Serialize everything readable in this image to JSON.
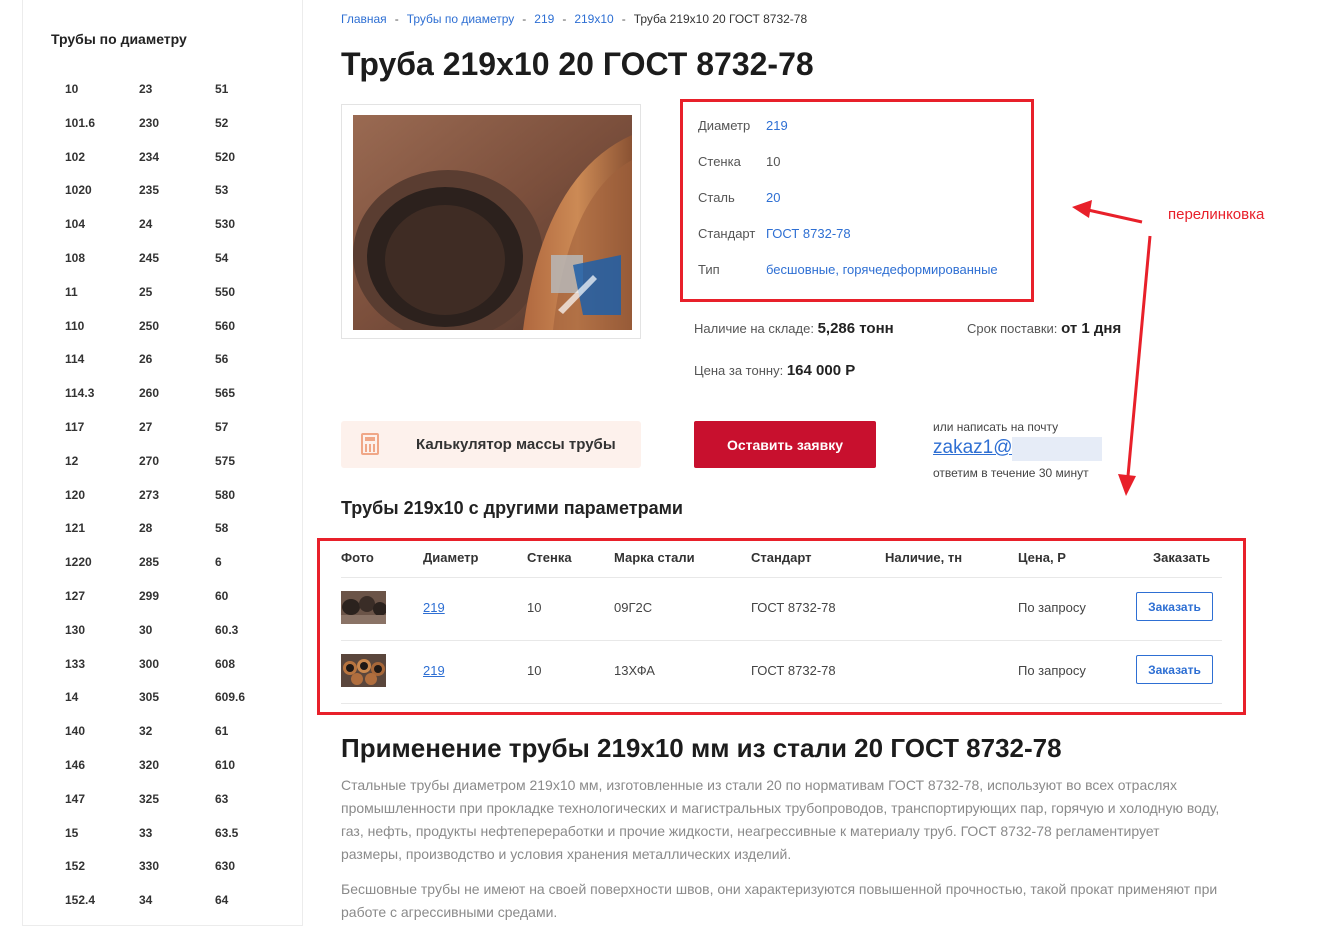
{
  "sidebar": {
    "title": "Трубы по диаметру",
    "diameters": [
      "10",
      "23",
      "51",
      "101.6",
      "230",
      "52",
      "102",
      "234",
      "520",
      "1020",
      "235",
      "53",
      "104",
      "24",
      "530",
      "108",
      "245",
      "54",
      "11",
      "25",
      "550",
      "110",
      "250",
      "560",
      "114",
      "26",
      "56",
      "114.3",
      "260",
      "565",
      "117",
      "27",
      "57",
      "12",
      "270",
      "575",
      "120",
      "273",
      "580",
      "121",
      "28",
      "58",
      "1220",
      "285",
      "6",
      "127",
      "299",
      "60",
      "130",
      "30",
      "60.3",
      "133",
      "300",
      "608",
      "14",
      "305",
      "609.6",
      "140",
      "32",
      "61",
      "146",
      "320",
      "610",
      "147",
      "325",
      "63",
      "15",
      "33",
      "63.5",
      "152",
      "330",
      "630",
      "152.4",
      "34",
      "64"
    ]
  },
  "breadcrumb": {
    "items": [
      "Главная",
      "Трубы по диаметру",
      "219",
      "219x10"
    ],
    "current": "Труба 219x10 20 ГОСТ 8732-78",
    "separator": "-"
  },
  "title": "Труба 219x10 20 ГОСТ 8732-78",
  "props": [
    {
      "key": "Диаметр",
      "value": "219",
      "link": true
    },
    {
      "key": "Стенка",
      "value": "10",
      "link": false
    },
    {
      "key": "Сталь",
      "value": "20",
      "link": true
    },
    {
      "key": "Стандарт",
      "value": "ГОСТ 8732-78",
      "link": true
    },
    {
      "key": "Тип",
      "value": "бесшовные, горячедеформированные",
      "link": true
    }
  ],
  "stock": {
    "label": "Наличие на складе:",
    "value": "5,286 тонн"
  },
  "delivery": {
    "label": "Срок поставки:",
    "value": "от 1 дня"
  },
  "price": {
    "label": "Цена за тонну:",
    "value": "164 000 Р"
  },
  "buttons": {
    "calculator": "Калькулятор массы трубы",
    "order": "Оставить заявку"
  },
  "mail": {
    "note": "или написать на почту",
    "address": "zakaz1@",
    "reply": "ответим в течение 30 минут"
  },
  "annotation": "перелинковка",
  "related": {
    "heading": "Трубы 219x10 с другими параметрами",
    "columns": [
      "Фото",
      "Диаметр",
      "Стенка",
      "Марка стали",
      "Стандарт",
      "Наличие, тн",
      "Цена, Р",
      "Заказать"
    ],
    "rows": [
      {
        "diameter": "219",
        "wall": "10",
        "steel": "09Г2С",
        "standard": "ГОСТ 8732-78",
        "stock": "",
        "price": "По запросу",
        "order": "Заказать"
      },
      {
        "diameter": "219",
        "wall": "10",
        "steel": "13ХФА",
        "standard": "ГОСТ 8732-78",
        "stock": "",
        "price": "По запросу",
        "order": "Заказать"
      }
    ]
  },
  "application": {
    "heading": "Применение трубы 219x10 мм из стали 20 ГОСТ 8732-78",
    "p1": "Стальные трубы диаметром 219x10 мм, изготовленные из стали 20 по нормативам ГОСТ 8732-78, используют во всех отраслях промышленности при прокладке технологических и магистральных трубопроводов, транспортирующих пар, горячую и холодную воду, газ, нефть, продукты нефтепереработки и прочие жидкости, неагрессивные к материалу труб. ГОСТ 8732-78 регламентирует размеры, производство и условия хранения металлических изделий.",
    "p2": "Бесшовные трубы не имеют на своей поверхности швов, они характеризуются повышенной прочностью, такой прокат применяют при работе с агрессивными средами."
  },
  "colors": {
    "link": "#2e6fd3",
    "accent": "#c8102e",
    "annotation": "#e8202a"
  }
}
